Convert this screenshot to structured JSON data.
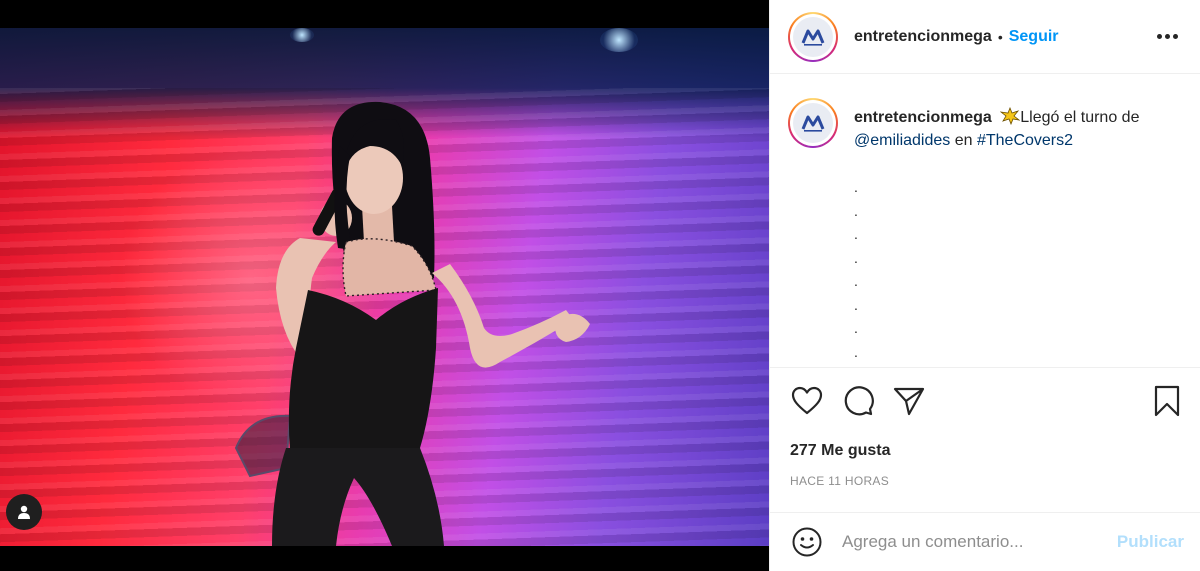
{
  "post": {
    "account": {
      "username": "entretencionmega",
      "avatar_icon": "mega-logo-icon"
    },
    "header": {
      "separator": "•",
      "follow_label": "Seguir",
      "more_icon": "more-options-icon"
    },
    "caption": {
      "username": "entretencionmega",
      "emoji": "star-burst-icon",
      "text_1": "Llegó el turno de",
      "mention": "@emiliadides",
      "text_2": " en ",
      "hashtag": "#TheCovers2",
      "dots": [
        ".",
        ".",
        ".",
        ".",
        ".",
        ".",
        ".",
        "."
      ]
    },
    "actions": {
      "like_icon": "heart-icon",
      "comment_icon": "comment-icon",
      "share_icon": "share-icon",
      "save_icon": "bookmark-icon"
    },
    "likes_text": "277 Me gusta",
    "timestamp": "HACE 11 HORAS",
    "comment_box": {
      "placeholder": "Agrega un comentario...",
      "publish_label": "Publicar",
      "emoji_icon": "smiley-icon"
    },
    "media": {
      "tag_icon": "user-tag-icon"
    }
  },
  "colors": {
    "link_blue": "#0095f6",
    "mention_blue": "#00376b",
    "muted": "#8e8e8e",
    "publish_disabled": "#b2dffc"
  }
}
